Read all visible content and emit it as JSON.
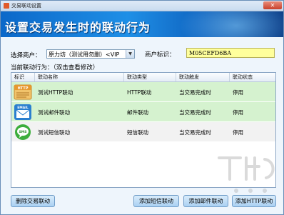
{
  "window": {
    "title": "交易联动设置"
  },
  "banner": {
    "heading": "设置交易发生时的联动行为"
  },
  "form": {
    "merchant_label": "选择商户：",
    "merchant_value": "原力坊（测试用勿删）<VIP",
    "merchant_id_label": "商户标识：",
    "merchant_id_value": "M05CEFD6BA"
  },
  "section": {
    "label": "当前联动行为：（双击查看修改）"
  },
  "table": {
    "columns": [
      "标识",
      "联动名称",
      "联动类型",
      "联动触发",
      "联动状态"
    ],
    "rows": [
      {
        "icon": "http-icon",
        "icon_text": "HTTP",
        "name": "测试HTTP联动",
        "type": "HTTP联动",
        "trigger": "当交易完成时",
        "status": "停用"
      },
      {
        "icon": "email-icon",
        "icon_text": "EMAIL",
        "name": "测试邮件联动",
        "type": "邮件联动",
        "trigger": "当交易完成时",
        "status": "停用"
      },
      {
        "icon": "sms-icon",
        "icon_text": "SMS",
        "name": "测试短信联动",
        "type": "短信联动",
        "trigger": "当交易完成时",
        "status": "停用"
      }
    ]
  },
  "buttons": {
    "delete": "删除交易联动",
    "add_sms": "添加短信联动",
    "add_email": "添加邮件联动",
    "add_http": "添加HTTP联动"
  },
  "colors": {
    "banner": "#1f8fe6",
    "row_bg": "#d5f2cf",
    "id_bg": "#ffff9c"
  }
}
